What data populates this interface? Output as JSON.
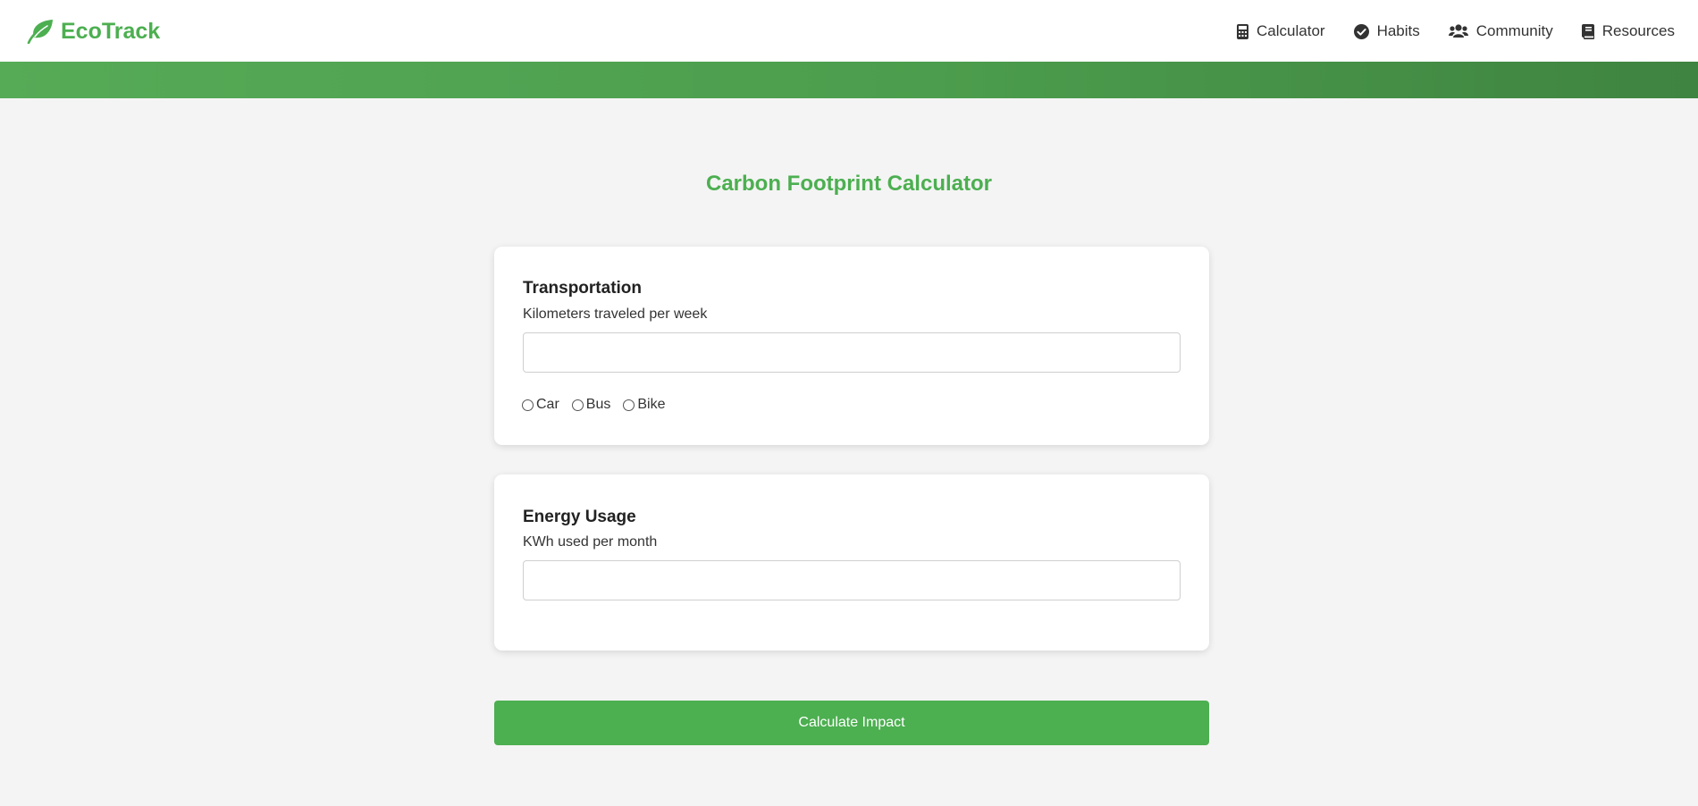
{
  "header": {
    "brand": {
      "name": "EcoTrack",
      "icon": "leaf-icon",
      "color": "#4caf50"
    },
    "nav": [
      {
        "label": "Calculator",
        "icon": "calculator-icon"
      },
      {
        "label": "Habits",
        "icon": "check-circle-icon"
      },
      {
        "label": "Community",
        "icon": "users-icon"
      },
      {
        "label": "Resources",
        "icon": "book-icon"
      }
    ]
  },
  "banner": {
    "gradient_start": "#56ab57",
    "gradient_end": "#3f8441"
  },
  "main": {
    "title": "Carbon Footprint Calculator",
    "transportation": {
      "heading": "Transportation",
      "field_label": "Kilometers traveled per week",
      "value": "",
      "placeholder": "",
      "modes": [
        {
          "label": "Car",
          "selected": false
        },
        {
          "label": "Bus",
          "selected": false
        },
        {
          "label": "Bike",
          "selected": false
        }
      ]
    },
    "energy": {
      "heading": "Energy Usage",
      "field_label": "KWh used per month",
      "value": "",
      "placeholder": ""
    },
    "calculate_button": {
      "label": "Calculate Impact",
      "color": "#4caf50"
    }
  }
}
